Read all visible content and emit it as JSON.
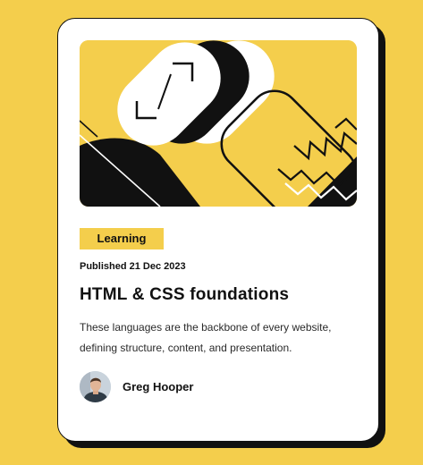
{
  "card": {
    "tag": "Learning",
    "published": "Published 21 Dec 2023",
    "title": "HTML & CSS foundations",
    "description": "These languages are the backbone of every website, defining structure, content, and presentation.",
    "author": {
      "name": "Greg Hooper"
    }
  },
  "theme": {
    "background": "#f4ce4c",
    "card": "#ffffff",
    "ink": "#111111"
  },
  "icons": {
    "hero": "abstract-illustration",
    "avatar": "author-photo"
  }
}
